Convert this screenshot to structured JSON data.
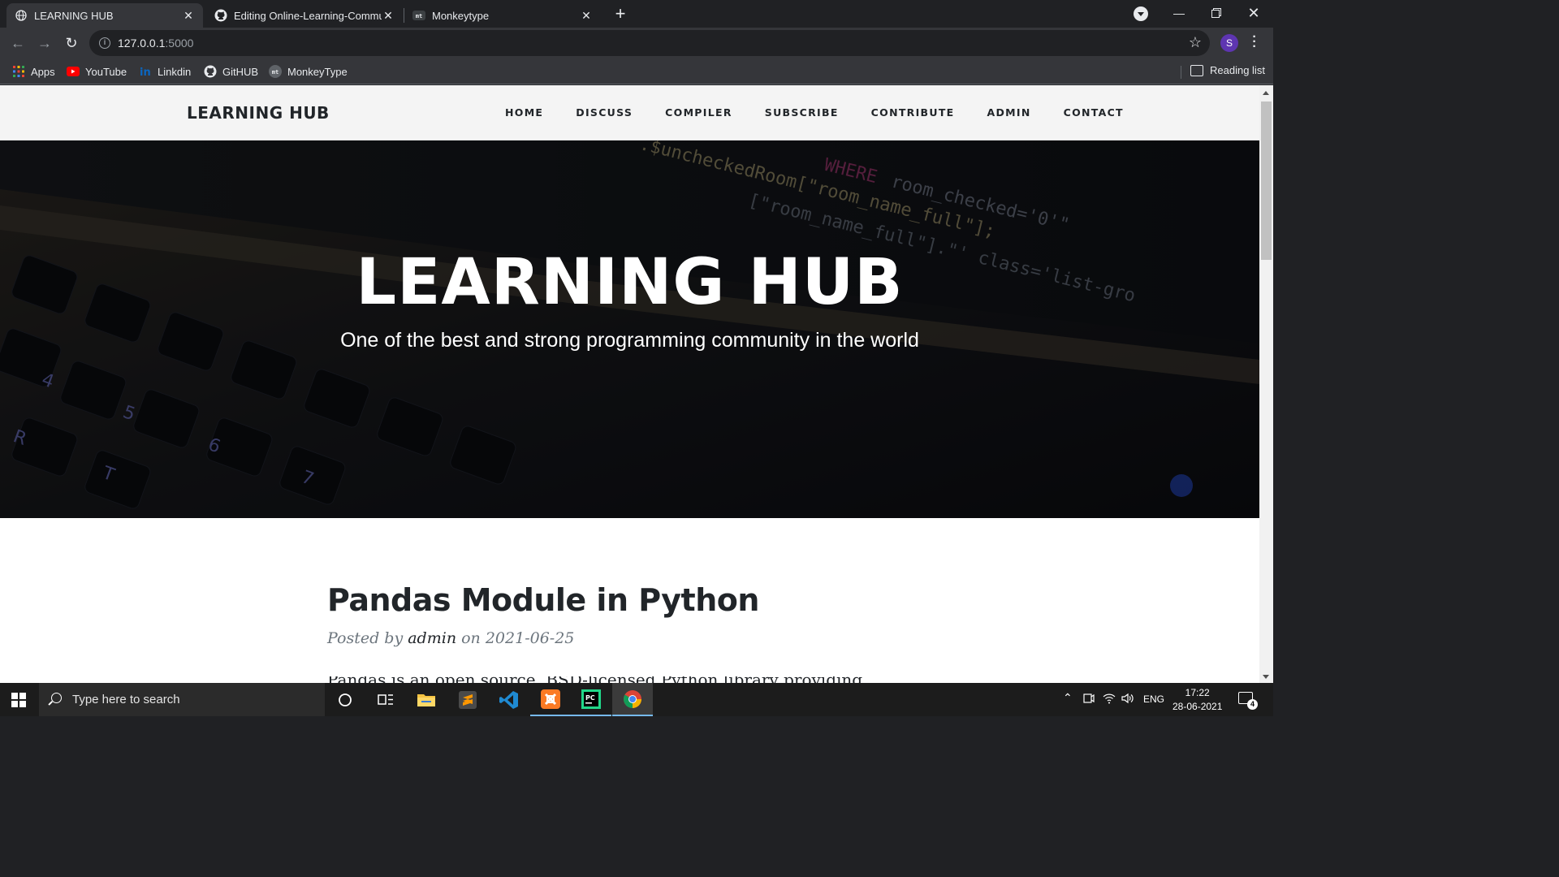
{
  "browser": {
    "tabs": [
      {
        "title": "LEARNING HUB",
        "icon": "globe-icon"
      },
      {
        "title": "Editing Online-Learning-Commu",
        "icon": "github-icon"
      },
      {
        "title": "Monkeytype",
        "icon": "monkeytype-icon"
      }
    ],
    "url_host": "127.0.0.1",
    "url_port": ":5000",
    "profile_initial": "S",
    "bookmarks": [
      {
        "label": "Apps",
        "icon": "apps-grid-icon"
      },
      {
        "label": "YouTube",
        "icon": "youtube-icon"
      },
      {
        "label": "Linkdin",
        "icon": "linkedin-icon"
      },
      {
        "label": "GitHUB",
        "icon": "github-icon"
      },
      {
        "label": "MonkeyType",
        "icon": "monkeytype-icon"
      }
    ],
    "reading_list": "Reading list"
  },
  "site": {
    "brand": "LEARNING HUB",
    "nav": [
      "HOME",
      "DISCUSS",
      "COMPILER",
      "SUBSCRIBE",
      "CONTRIBUTE",
      "ADMIN",
      "CONTACT"
    ],
    "hero_title": "LEARNING HUB",
    "hero_subtitle": "One of the best and strong programming community in the world",
    "post": {
      "title": "Pandas Module in Python",
      "meta_prefix": "Posted by",
      "author": "admin",
      "meta_on": "on",
      "date": "2021-06-25",
      "excerpt": "Pandas is an open source, BSD-licensed Python library providing high"
    }
  },
  "taskbar": {
    "search_placeholder": "Type here to search",
    "language": "ENG",
    "time": "17:22",
    "date": "28-06-2021",
    "notification_count": "4"
  },
  "colors": {
    "browser_frame": "#202124",
    "browser_toolbar": "#35363a",
    "nav_bg": "#f4f4f4",
    "text_dark": "#212529",
    "meta_grey": "#6c757d",
    "taskbar": "#1c1c1c"
  }
}
